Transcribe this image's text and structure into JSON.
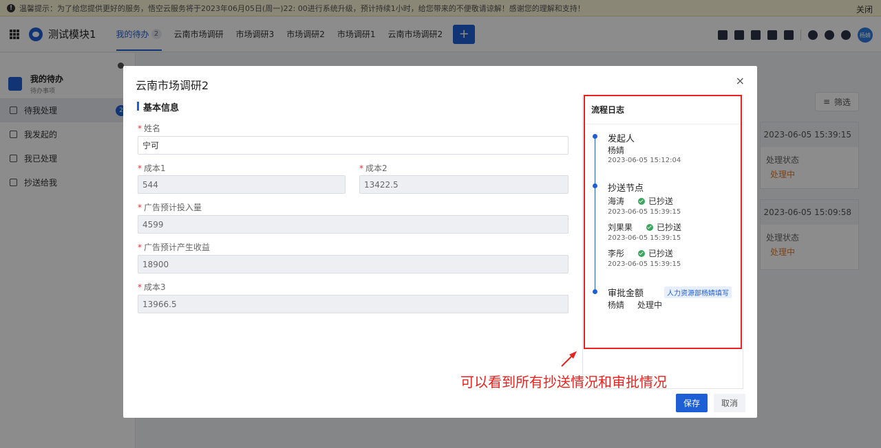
{
  "notice": {
    "text": "温馨提示：为了给您提供更好的服务，悟空云服务将于2023年06月05日(周一)22: 00进行系统升级，预计持续1小时，给您带来的不便敬请谅解！感谢您的理解和支持！",
    "close_label": "关闭"
  },
  "header": {
    "module_title": "测试模块1",
    "tabs": [
      {
        "label": "我的待办",
        "badge": "2"
      },
      {
        "label": "云南市场调研"
      },
      {
        "label": "市场调研3"
      },
      {
        "label": "市场调研2"
      },
      {
        "label": "市场调研1"
      },
      {
        "label": "云南市场调研2"
      }
    ],
    "add_label": "+",
    "avatar_text": "杨婧"
  },
  "sidebar": {
    "title": "我的待办",
    "subtitle": "待办事项",
    "items": [
      {
        "label": "待我处理",
        "count": "2"
      },
      {
        "label": "我发起的"
      },
      {
        "label": "我已处理"
      },
      {
        "label": "抄送给我"
      }
    ]
  },
  "background": {
    "filter_label": "筛选",
    "cards": [
      {
        "date": "2023-06-05 15:39:15",
        "key": "处理状态",
        "value": "处理中"
      },
      {
        "date": "2023-06-05 15:09:58",
        "key": "处理状态",
        "value": "处理中"
      }
    ]
  },
  "modal": {
    "title": "云南市场调研2",
    "close_label": "×",
    "section_title": "基本信息",
    "fields": {
      "name": {
        "label": "姓名",
        "value": "宁可"
      },
      "cost1": {
        "label": "成本1",
        "value": "544"
      },
      "cost2": {
        "label": "成本2",
        "value": "13422.5"
      },
      "ad_invest": {
        "label": "广告预计投入量",
        "value": "4599"
      },
      "ad_revenue": {
        "label": "广告预计产生收益",
        "value": "18900"
      },
      "cost3": {
        "label": "成本3",
        "value": "13966.5"
      }
    },
    "required_mark": "*",
    "log": {
      "title": "流程日志",
      "initiator": {
        "title": "发起人",
        "person": "杨婧",
        "time": "2023-06-05 15:12:04"
      },
      "cc": {
        "title": "抄送节点",
        "entries": [
          {
            "person": "海涛",
            "status": "已抄送",
            "time": "2023-06-05 15:39:15"
          },
          {
            "person": "刘果果",
            "status": "已抄送",
            "time": "2023-06-05 15:39:15"
          },
          {
            "person": "李彤",
            "status": "已抄送",
            "time": "2023-06-05 15:39:15"
          }
        ]
      },
      "approval": {
        "title": "审批金额",
        "tag": "人力资源部杨婧填写",
        "person": "杨婧",
        "status": "处理中"
      }
    },
    "save_label": "保存",
    "cancel_label": "取消"
  },
  "annotation": {
    "text": "可以看到所有抄送情况和审批情况",
    "color": "#e8231f"
  }
}
